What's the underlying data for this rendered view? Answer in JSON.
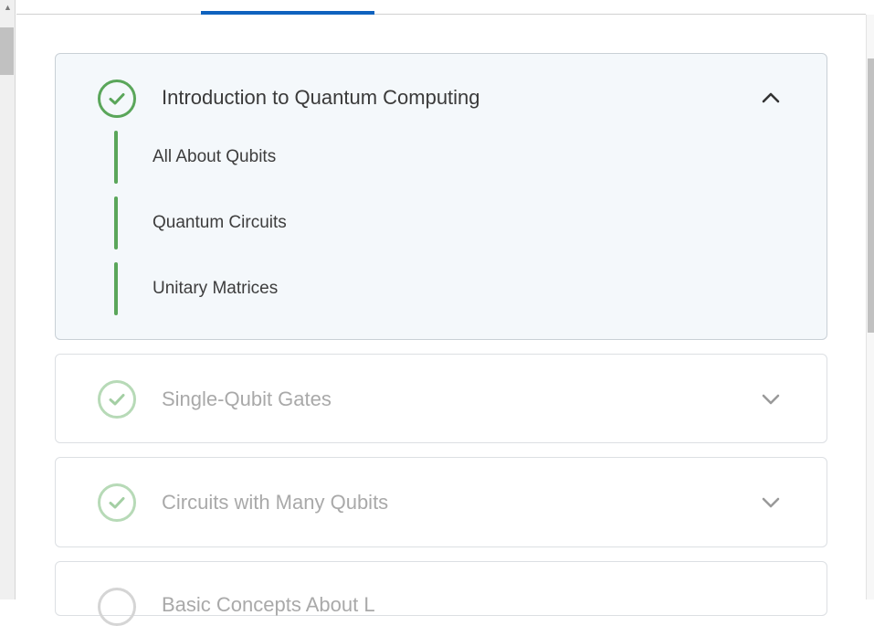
{
  "colors": {
    "accent": "#0f62be",
    "complete_green": "#5aa65a",
    "faded_green": "#b7dab7",
    "expanded_bg": "#f4f8fb"
  },
  "modules": [
    {
      "title": "Introduction to Quantum Computing",
      "expanded": true,
      "status": "complete",
      "toggle_icon": "chevron-up-icon",
      "lessons": [
        {
          "label": "All About Qubits"
        },
        {
          "label": "Quantum Circuits"
        },
        {
          "label": "Unitary Matrices"
        }
      ]
    },
    {
      "title": "Single-Qubit Gates",
      "expanded": false,
      "status": "complete",
      "toggle_icon": "chevron-down-icon"
    },
    {
      "title": "Circuits with Many Qubits",
      "expanded": false,
      "status": "complete",
      "toggle_icon": "chevron-down-icon"
    },
    {
      "title": "Basic Concepts About L",
      "expanded": false,
      "status": "incomplete"
    }
  ]
}
